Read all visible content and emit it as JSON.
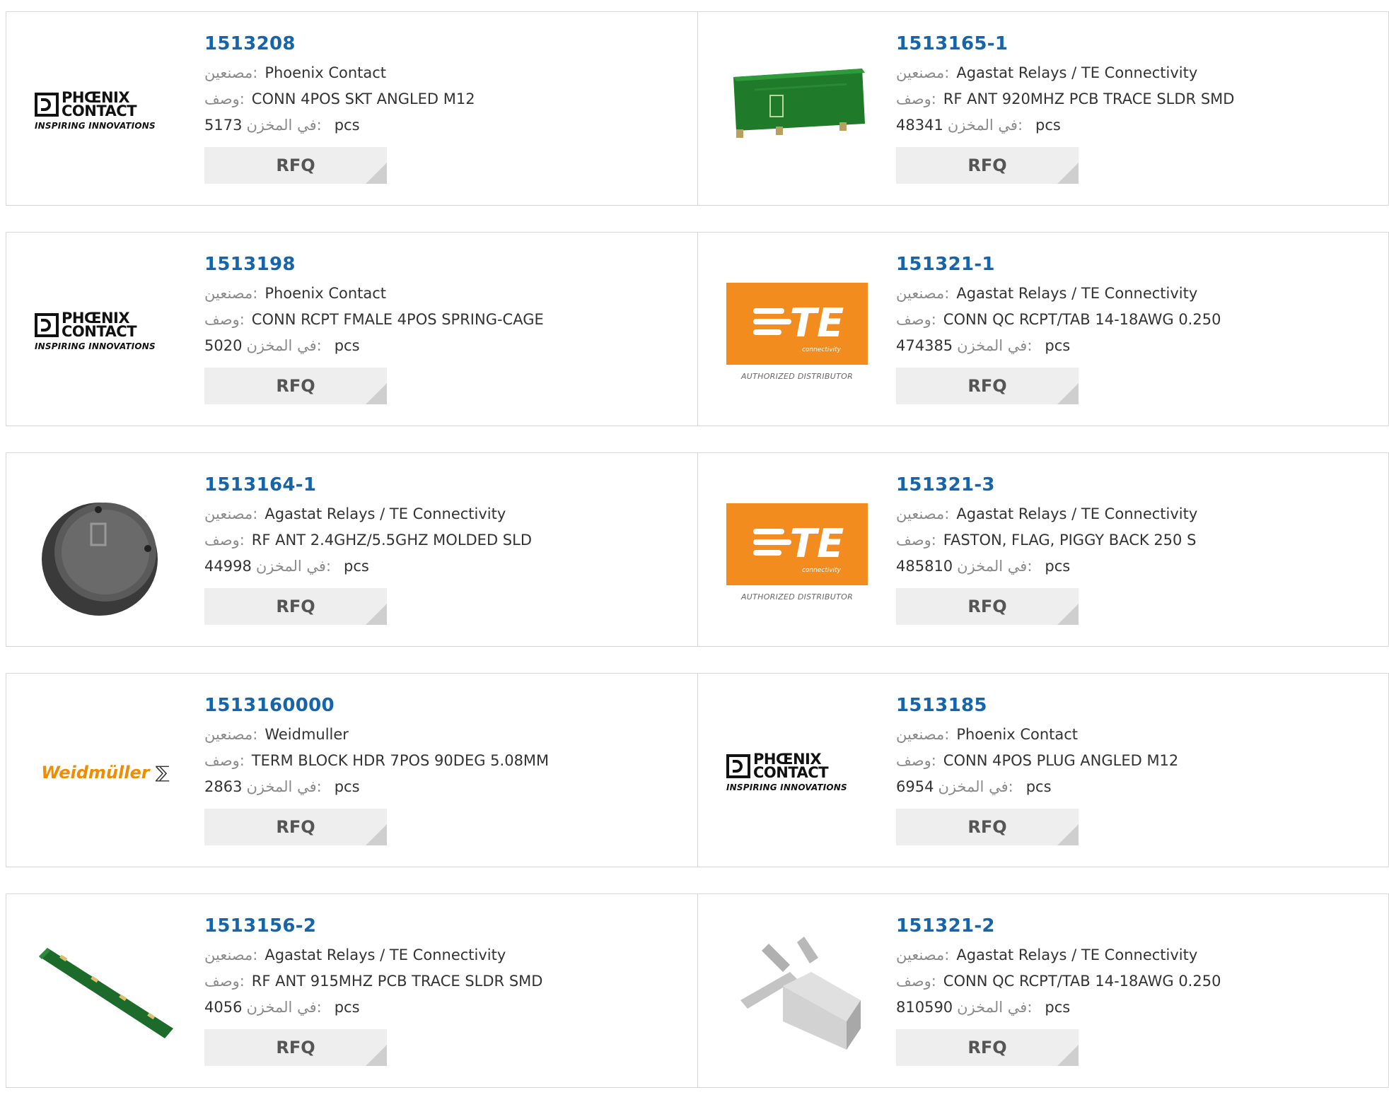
{
  "labels": {
    "manufacturer": "مصنعين:",
    "description": "وصف:",
    "in_stock": "في المخزن:",
    "unit": "pcs",
    "button": "RFQ"
  },
  "rows": [
    [
      {
        "part": "1513208",
        "mfr": "Phoenix Contact",
        "desc": "CONN 4POS SKT ANGLED M12",
        "stock": "5173",
        "image": "phoenix-logo"
      },
      {
        "part": "1513165-1",
        "mfr": "Agastat Relays / TE Connectivity",
        "desc": "RF ANT 920MHZ PCB TRACE SLDR SMD",
        "stock": "48341",
        "image": "pcb-antenna-photo"
      }
    ],
    [
      {
        "part": "1513198",
        "mfr": "Phoenix Contact",
        "desc": "CONN RCPT FMALE 4POS SPRING-CAGE",
        "stock": "5020",
        "image": "phoenix-logo"
      },
      {
        "part": "151321-1",
        "mfr": "Agastat Relays / TE Connectivity",
        "desc": "CONN QC RCPT/TAB 14-18AWG 0.250",
        "stock": "474385",
        "image": "te-logo"
      }
    ],
    [
      {
        "part": "1513164-1",
        "mfr": "Agastat Relays / TE Connectivity",
        "desc": "RF ANT 2.4GHZ/5.5GHZ MOLDED SLD",
        "stock": "44998",
        "image": "molded-antenna-photo"
      },
      {
        "part": "151321-3",
        "mfr": "Agastat Relays / TE Connectivity",
        "desc": "FASTON, FLAG, PIGGY BACK 250 S",
        "stock": "485810",
        "image": "te-logo"
      }
    ],
    [
      {
        "part": "1513160000",
        "mfr": "Weidmuller",
        "desc": "TERM BLOCK HDR 7POS 90DEG 5.08MM",
        "stock": "2863",
        "image": "weidmuller-logo"
      },
      {
        "part": "1513185",
        "mfr": "Phoenix Contact",
        "desc": "CONN 4POS PLUG ANGLED M12",
        "stock": "6954",
        "image": "phoenix-logo"
      }
    ],
    [
      {
        "part": "1513156-2",
        "mfr": "Agastat Relays / TE Connectivity",
        "desc": "RF ANT 915MHZ PCB TRACE SLDR SMD",
        "stock": "4056",
        "image": "pcb-strip-antenna-photo"
      },
      {
        "part": "151321-2",
        "mfr": "Agastat Relays / TE Connectivity",
        "desc": "CONN QC RCPT/TAB 14-18AWG 0.250",
        "stock": "810590",
        "image": "quick-connect-terminal-photo"
      }
    ]
  ],
  "logos": {
    "phoenix": {
      "line1": "PHŒNIX",
      "line2": "CONTACT",
      "tagline": "INSPIRING INNOVATIONS"
    },
    "te": {
      "letters": "TE",
      "sub": "connectivity",
      "caption": "AUTHORIZED DISTRIBUTOR"
    },
    "weidmuller": {
      "text": "Weidmüller",
      "symbol": "⅀"
    }
  },
  "colors": {
    "link": "#1565ad",
    "te_orange": "#f28c1e",
    "weidmuller_orange": "#f08c00",
    "button_bg": "#eeeeee"
  }
}
